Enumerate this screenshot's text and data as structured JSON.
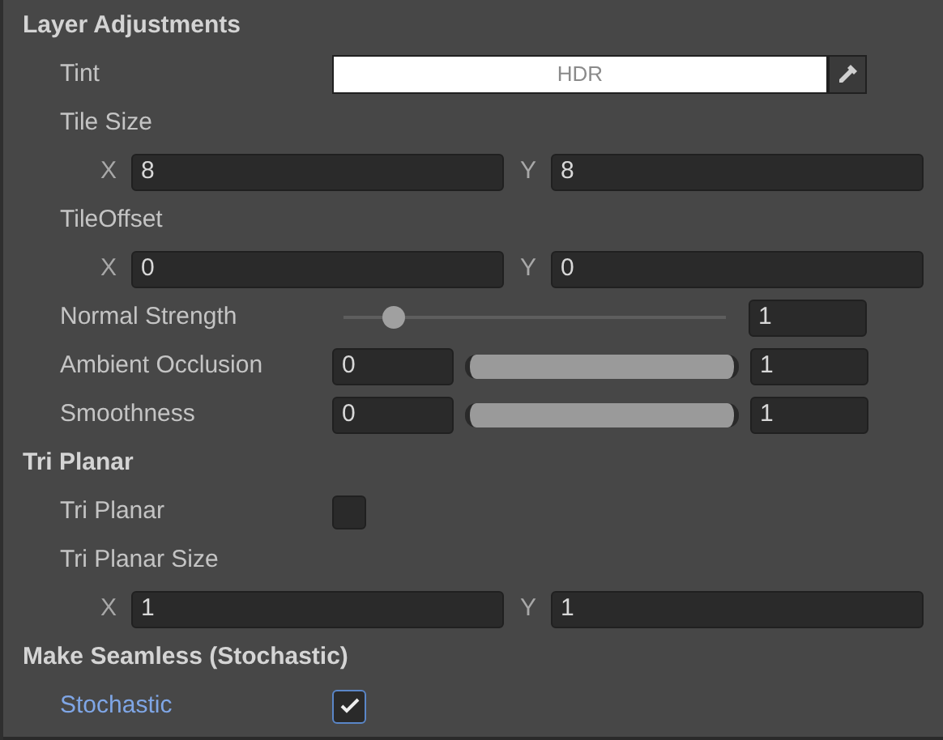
{
  "sections": [
    {
      "title": "Layer Adjustments",
      "rows": [
        {
          "kind": "color",
          "label": "Tint",
          "value": "HDR"
        },
        {
          "kind": "vector2",
          "label": "Tile Size",
          "fields": [
            {
              "axis": "X",
              "value": "8"
            },
            {
              "axis": "Y",
              "value": "8"
            }
          ]
        },
        {
          "kind": "vector2",
          "label": "TileOffset",
          "fields": [
            {
              "axis": "X",
              "value": "0"
            },
            {
              "axis": "Y",
              "value": "0"
            }
          ]
        },
        {
          "kind": "slider",
          "label": "Normal Strength",
          "level": 0.13,
          "value": "1"
        },
        {
          "kind": "minmax",
          "label": "Ambient Occlusion",
          "min": "0",
          "max": "1"
        },
        {
          "kind": "minmax",
          "label": "Smoothness",
          "min": "0",
          "max": "1"
        }
      ]
    },
    {
      "title": "Tri Planar",
      "rows": [
        {
          "kind": "toggle",
          "label": "Tri Planar",
          "checked": false,
          "highlighted": false
        },
        {
          "kind": "vector2",
          "label": "Tri Planar Size",
          "fields": [
            {
              "axis": "X",
              "value": "1"
            },
            {
              "axis": "Y",
              "value": "1"
            }
          ]
        }
      ]
    },
    {
      "title": "Make Seamless (Stochastic)",
      "rows": [
        {
          "kind": "toggle",
          "label": "Stochastic",
          "checked": true,
          "highlighted": true
        }
      ]
    }
  ]
}
